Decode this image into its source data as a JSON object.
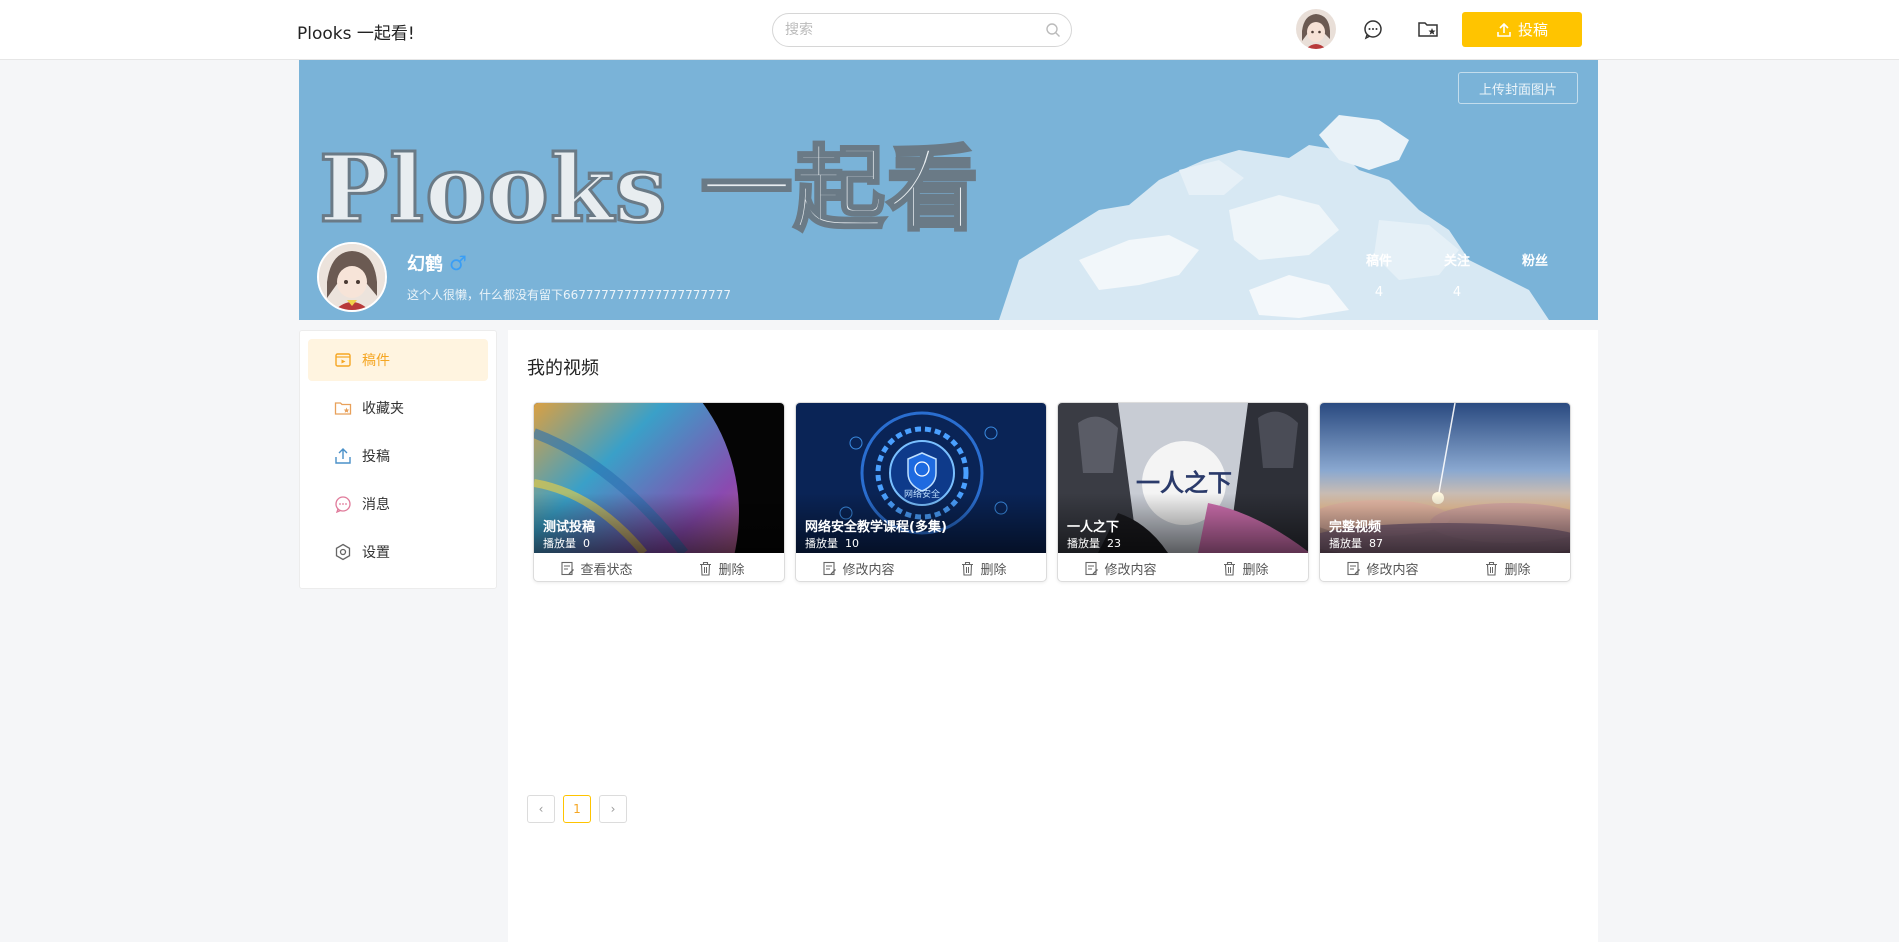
{
  "header": {
    "brand": "Plooks 一起看!",
    "search_placeholder": "搜索",
    "upload_label": "投稿"
  },
  "banner": {
    "title": "Plooks 一起看",
    "upload_cover_label": "上传封面图片",
    "username": "幻鹤",
    "gender_symbol": "♂",
    "bio": "这个人很懒，什么都没有留下6677777777777777777777",
    "stats": [
      {
        "label": "稿件",
        "value": "4"
      },
      {
        "label": "关注",
        "value": "4"
      },
      {
        "label": "粉丝",
        "value": ""
      }
    ]
  },
  "sidebar": {
    "items": [
      {
        "label": "稿件",
        "icon": "video-icon",
        "active": true
      },
      {
        "label": "收藏夹",
        "icon": "folder-star-icon",
        "active": false
      },
      {
        "label": "投稿",
        "icon": "upload-icon",
        "active": false
      },
      {
        "label": "消息",
        "icon": "message-icon",
        "active": false
      },
      {
        "label": "设置",
        "icon": "settings-icon",
        "active": false
      }
    ]
  },
  "main": {
    "title": "我的视频",
    "videos": [
      {
        "title": "测试投稿",
        "plays_label": "播放量",
        "plays": "0",
        "edit_label": "查看状态",
        "delete_label": "删除"
      },
      {
        "title": "网络安全教学课程(多集)",
        "plays_label": "播放量",
        "plays": "10",
        "edit_label": "修改内容",
        "delete_label": "删除",
        "thumb_text": "网络安全"
      },
      {
        "title": "一人之下",
        "plays_label": "播放量",
        "plays": "23",
        "edit_label": "修改内容",
        "delete_label": "删除",
        "thumb_text": "一人之下"
      },
      {
        "title": "完整视频",
        "plays_label": "播放量",
        "plays": "87",
        "edit_label": "修改内容",
        "delete_label": "删除"
      }
    ],
    "pagination": {
      "prev": "‹",
      "current": "1",
      "next": "›"
    }
  },
  "colors": {
    "accent": "#ffc400",
    "active_text": "#f5a623",
    "active_bg": "#fff4e0",
    "banner_bg": "#7ab3d8",
    "male": "#3a9ef5"
  }
}
